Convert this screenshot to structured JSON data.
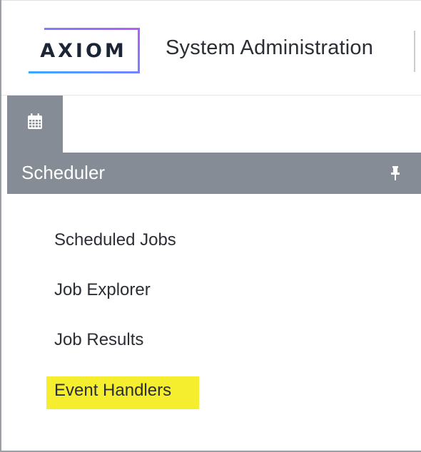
{
  "header": {
    "logo_text": "AXIOM",
    "title": "System Administration"
  },
  "tabs": [
    {
      "icon": "calendar-icon",
      "active": true
    }
  ],
  "panel": {
    "title": "Scheduler",
    "pin_icon": "pin-icon"
  },
  "nav": {
    "items": [
      {
        "label": "Scheduled Jobs"
      },
      {
        "label": "Job Explorer"
      },
      {
        "label": "Job Results"
      },
      {
        "label": "Event Handlers",
        "highlighted": true
      }
    ]
  },
  "colors": {
    "panel_bg": "#858c96",
    "highlight": "#f4ee2f",
    "logo_gradient_start": "#3aa8ff",
    "logo_gradient_end": "#b35cff",
    "text": "#2b2f35"
  }
}
